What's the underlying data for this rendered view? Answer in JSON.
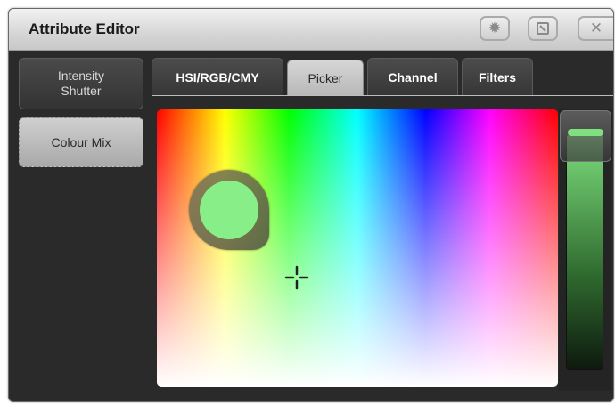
{
  "window": {
    "title": "Attribute Editor",
    "buttons": [
      {
        "name": "settings",
        "icon": "gear-icon"
      },
      {
        "name": "rotate",
        "icon": "rotate-icon"
      },
      {
        "name": "close",
        "icon": "close-icon"
      }
    ]
  },
  "sidebar": {
    "items": [
      {
        "label": "Intensity\nShutter",
        "active": false
      },
      {
        "label": "Colour Mix",
        "active": true
      }
    ]
  },
  "tabs": [
    {
      "label": "HSI/RGB/CMY",
      "active": false
    },
    {
      "label": "Picker",
      "active": true
    },
    {
      "label": "Channel",
      "active": false
    },
    {
      "label": "Filters",
      "active": false
    }
  ],
  "picker": {
    "selected_color": "#88ee88",
    "fader_color": "#7ee07e"
  }
}
